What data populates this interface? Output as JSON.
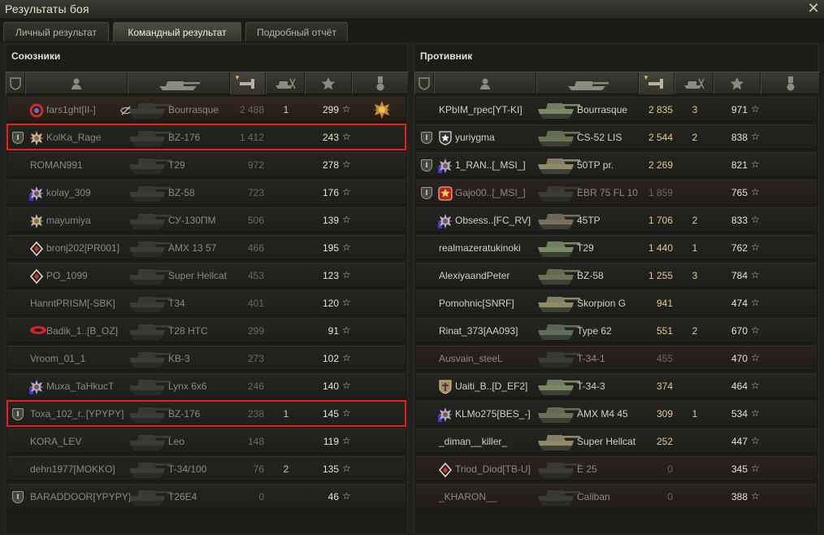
{
  "window": {
    "title": "Результаты боя",
    "close_icon": "close-icon"
  },
  "tabs": [
    {
      "label": "Личный результат",
      "active": false
    },
    {
      "label": "Командный результат",
      "active": true
    },
    {
      "label": "Подробный отчёт",
      "active": false
    }
  ],
  "columns": [
    "platoon-icon",
    "player-icon",
    "vehicle-icon",
    "damage-icon",
    "frags-icon",
    "xp-star-icon",
    "medal-icon"
  ],
  "allies": {
    "title": "Союзники",
    "rows": [
      {
        "platoon": "",
        "badge": "red-ring",
        "name": "fars1ght[II-]",
        "vehicle": "Bourrasque",
        "damage": "2 488",
        "kills": "1",
        "xp": "299",
        "alive": false,
        "medal": true,
        "highlight": false,
        "extra_icon": "eye-off-icon"
      },
      {
        "platoon": "I",
        "badge": "sun-emblem",
        "name": "KolKa_Rage",
        "vehicle": "BZ-176",
        "damage": "1 412",
        "kills": "",
        "xp": "243",
        "alive": false,
        "medal": false,
        "highlight": true
      },
      {
        "platoon": "",
        "badge": "",
        "name": "ROMAN991",
        "vehicle": "T29",
        "damage": "972",
        "kills": "",
        "xp": "278",
        "alive": false,
        "medal": false,
        "highlight": false
      },
      {
        "platoon": "",
        "badge": "blue-sun",
        "name": "kolay_309",
        "vehicle": "BZ-58",
        "damage": "723",
        "kills": "",
        "xp": "176",
        "alive": false,
        "medal": false,
        "highlight": false
      },
      {
        "platoon": "",
        "badge": "sun-emblem",
        "name": "mayumiya",
        "vehicle": "СУ-130ПМ",
        "damage": "506",
        "kills": "",
        "xp": "139",
        "alive": false,
        "medal": false,
        "highlight": false
      },
      {
        "platoon": "",
        "badge": "diamond",
        "name": "bronj202[PR001]",
        "vehicle": "AMX 13 57",
        "damage": "466",
        "kills": "",
        "xp": "195",
        "alive": false,
        "medal": false,
        "highlight": false
      },
      {
        "platoon": "",
        "badge": "diamond",
        "name": "PO_1099",
        "vehicle": "Super Hellcat",
        "damage": "453",
        "kills": "",
        "xp": "123",
        "alive": false,
        "medal": false,
        "highlight": false
      },
      {
        "platoon": "",
        "badge": "",
        "name": "HanntPRISM[-SBK]",
        "vehicle": "T34",
        "damage": "401",
        "kills": "",
        "xp": "120",
        "alive": false,
        "medal": false,
        "highlight": false
      },
      {
        "platoon": "",
        "badge": "red-eye",
        "name": "Badik_1..[B_OZ]",
        "vehicle": "T28 HTC",
        "damage": "299",
        "kills": "",
        "xp": "91",
        "alive": false,
        "medal": false,
        "highlight": false
      },
      {
        "platoon": "",
        "badge": "",
        "name": "Vroom_01_1",
        "vehicle": "KB-3",
        "damage": "273",
        "kills": "",
        "xp": "102",
        "alive": false,
        "medal": false,
        "highlight": false
      },
      {
        "platoon": "",
        "badge": "blue-sun",
        "name": "Muxa_TaHkucT",
        "vehicle": "Lynx 6x6",
        "damage": "246",
        "kills": "",
        "xp": "140",
        "alive": false,
        "medal": false,
        "highlight": false
      },
      {
        "platoon": "I",
        "badge": "",
        "name": "Toxa_102_r..[YPYPY]",
        "vehicle": "BZ-176",
        "damage": "238",
        "kills": "1",
        "xp": "145",
        "alive": false,
        "medal": false,
        "highlight": true
      },
      {
        "platoon": "",
        "badge": "",
        "name": "KORA_LEV",
        "vehicle": "Leo",
        "damage": "148",
        "kills": "",
        "xp": "119",
        "alive": false,
        "medal": false,
        "highlight": false
      },
      {
        "platoon": "",
        "badge": "",
        "name": "dehn1977[MOKKO]",
        "vehicle": "T-34/100",
        "damage": "76",
        "kills": "2",
        "xp": "135",
        "alive": false,
        "medal": false,
        "highlight": false
      },
      {
        "platoon": "I",
        "badge": "",
        "name": "BARADDOOR[YPYPY]",
        "vehicle": "T26E4",
        "damage": "0",
        "kills": "",
        "xp": "46",
        "alive": false,
        "medal": false,
        "highlight": false
      }
    ]
  },
  "enemies": {
    "title": "Противник",
    "rows": [
      {
        "platoon": "",
        "badge": "",
        "name": "KPbIM_rpec[YT-KI]",
        "vehicle": "Bourrasque",
        "damage": "2 835",
        "kills": "3",
        "xp": "971",
        "alive": true,
        "highlight": false
      },
      {
        "platoon": "I",
        "badge": "star-shield",
        "name": "yuriygma",
        "vehicle": "CS-52 LIS",
        "damage": "2 544",
        "kills": "2",
        "xp": "838",
        "alive": true,
        "highlight": false
      },
      {
        "platoon": "I",
        "badge": "blue-sun",
        "name": "1_RAN..[_MSI_]",
        "vehicle": "50TP pr.",
        "damage": "2 269",
        "kills": "",
        "xp": "821",
        "alive": true,
        "highlight": false
      },
      {
        "platoon": "I",
        "badge": "red-star",
        "name": "Gajo00..[_MSI_]",
        "vehicle": "EBR 75 FL 10",
        "damage": "1 859",
        "kills": "",
        "xp": "765",
        "alive": false,
        "highlight": false
      },
      {
        "platoon": "",
        "badge": "blue-sun",
        "name": "Obsess..[FC_RV]",
        "vehicle": "45TP",
        "damage": "1 706",
        "kills": "2",
        "xp": "833",
        "alive": true,
        "highlight": false
      },
      {
        "platoon": "",
        "badge": "",
        "name": "realmazeratukinoki",
        "vehicle": "T29",
        "damage": "1 440",
        "kills": "1",
        "xp": "762",
        "alive": true,
        "highlight": false
      },
      {
        "platoon": "",
        "badge": "",
        "name": "AlexiyaandPeter",
        "vehicle": "BZ-58",
        "damage": "1 255",
        "kills": "3",
        "xp": "784",
        "alive": true,
        "highlight": false
      },
      {
        "platoon": "",
        "badge": "",
        "name": "Pomohnic[SNRF]",
        "vehicle": "Skorpion G",
        "damage": "941",
        "kills": "",
        "xp": "474",
        "alive": true,
        "highlight": false
      },
      {
        "platoon": "",
        "badge": "",
        "name": "Rinat_373[AA093]",
        "vehicle": "Type 62",
        "damage": "551",
        "kills": "2",
        "xp": "670",
        "alive": true,
        "highlight": false
      },
      {
        "platoon": "",
        "badge": "",
        "name": "Ausvain_steeL",
        "vehicle": "T-34-1",
        "damage": "455",
        "kills": "",
        "xp": "470",
        "alive": false,
        "highlight": false
      },
      {
        "platoon": "",
        "badge": "gold-shield",
        "name": "Uaiti_B..[D_EF2]",
        "vehicle": "T-34-3",
        "damage": "374",
        "kills": "",
        "xp": "464",
        "alive": true,
        "highlight": false
      },
      {
        "platoon": "",
        "badge": "blue-sun",
        "name": "KLMo275[BES_-]",
        "vehicle": "AMX M4 45",
        "damage": "309",
        "kills": "1",
        "xp": "534",
        "alive": true,
        "highlight": false
      },
      {
        "platoon": "",
        "badge": "",
        "name": "_diman__killer_",
        "vehicle": "Super Hellcat",
        "damage": "252",
        "kills": "",
        "xp": "447",
        "alive": true,
        "highlight": false
      },
      {
        "platoon": "",
        "badge": "diamond",
        "name": "Triod_Diod[TB-U]",
        "vehicle": "E 25",
        "damage": "0",
        "kills": "",
        "xp": "345",
        "alive": false,
        "highlight": false
      },
      {
        "platoon": "",
        "badge": "",
        "name": "_KHARON__",
        "vehicle": "Caliban",
        "damage": "0",
        "kills": "",
        "xp": "388",
        "alive": false,
        "highlight": false
      }
    ]
  },
  "colors": {
    "accent": "#e0b850",
    "highlight_box": "#ee1e1e",
    "alive_damage": "#e4c88a"
  }
}
